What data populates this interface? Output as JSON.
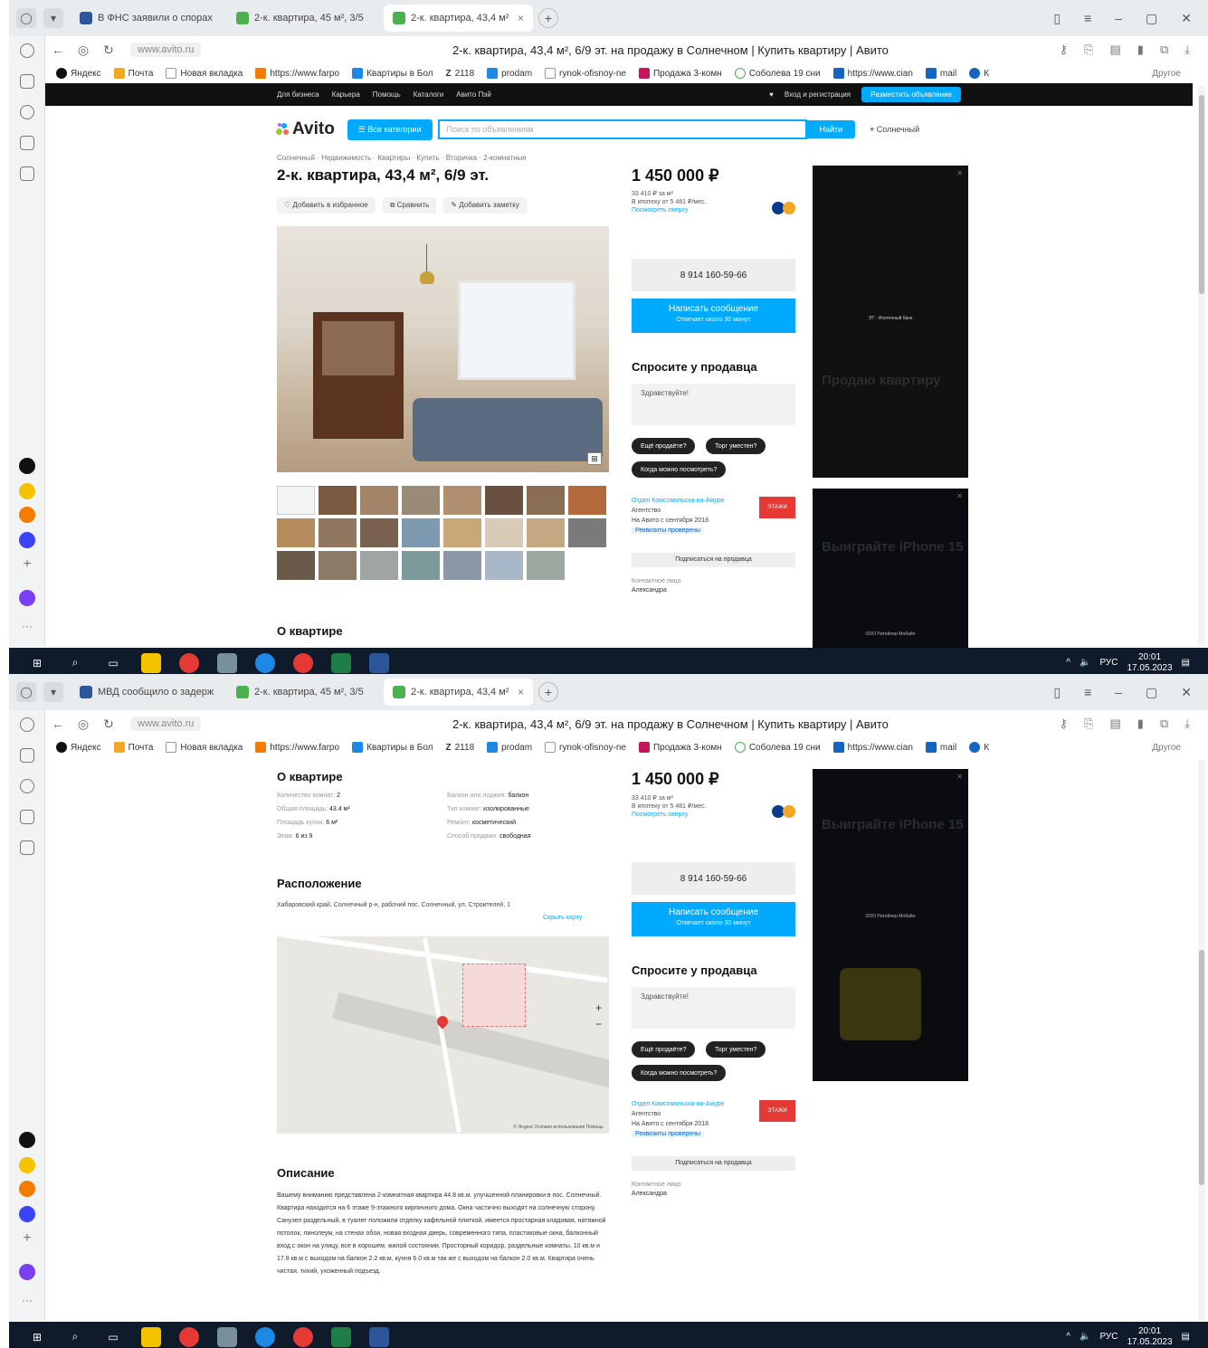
{
  "browser": {
    "tabs": [
      {
        "label": "В ФНС заявили о спорах",
        "color": "#2b579a"
      },
      {
        "label": "2-к. квартира, 45 м², 3/5",
        "color": "#4caf50"
      },
      {
        "label": "2-к. квартира, 43,4 м²",
        "color": "#4caf50"
      }
    ],
    "tabs_shot2": [
      {
        "label": "МВД сообщило о задерж",
        "color": "#2b579a"
      },
      {
        "label": "2-к. квартира, 45 м², 3/5",
        "color": "#4caf50"
      },
      {
        "label": "2-к. квартира, 43,4 м²",
        "color": "#4caf50"
      }
    ],
    "url": "www.avito.ru",
    "page_title": "2-к. квартира, 43,4 м², 6/9 эт. на продажу в Солнечном | Купить квартиру | Авито",
    "bookmarks": [
      {
        "label": "Яндекс",
        "color": "#111"
      },
      {
        "label": "Почта",
        "color": "#f5a623"
      },
      {
        "label": "Новая вкладка",
        "color": "#ccc"
      },
      {
        "label": "https://www.farpo",
        "color": "#f57c00"
      },
      {
        "label": "Квартиры в Бол",
        "color": "#1e88e5"
      },
      {
        "label": "2118",
        "color": "#333"
      },
      {
        "label": "prodam",
        "color": "#1e88e5"
      },
      {
        "label": "rynok-ofisnoy-ne",
        "color": "#ccc"
      },
      {
        "label": "Продажа 3-комн",
        "color": "#c2185b"
      },
      {
        "label": "Соболева 19 сни",
        "color": "#4caf50"
      },
      {
        "label": "https://www.cian",
        "color": "#1565c0"
      },
      {
        "label": "mail",
        "color": "#1565c0"
      },
      {
        "label": "К",
        "color": "#1565c0"
      }
    ],
    "bookmarks_more": "Другое",
    "clock_time": "20:01",
    "clock_date": "17.05.2023",
    "lang": "РУС"
  },
  "avito": {
    "top_links": [
      "Для бизнеса",
      "Карьера",
      "Помощь",
      "Каталоги",
      "Авито Пэй"
    ],
    "login": "Вход и регистрация",
    "post_ad": "Разместить объявление",
    "logo": "Avito",
    "categories_btn": "Все категории",
    "search_placeholder": "Поиск по объявлениям",
    "search_btn": "Найти",
    "location": "Солнечный",
    "breadcrumbs": "Солнечный · Недвижимость · Квартиры · Купить · Вторичка · 2-комнатные",
    "title": "2-к. квартира, 43,4 м², 6/9 эт.",
    "actions": [
      "Добавить в избранное",
      "Сравнить",
      "Добавить заметку"
    ],
    "price": "1 450 000 ₽",
    "price_per_m": "33 410 ₽ за м²",
    "mortgage": "В ипотеку от 5 481 ₽/мес.",
    "mortgage_link": "Посмотреть сверху",
    "phone": "8 914 160-59-66",
    "message_btn": "Написать сообщение",
    "message_sub": "Отвечает около 30 минут",
    "ask_heading": "Спросите у продавца",
    "ask_placeholder": "Здравствуйте!",
    "chips": [
      "Ещё продаёте?",
      "Торг уместен?",
      "Когда можно посмотреть?"
    ],
    "seller_name": "Отдел Комсомольска-на-Амуре",
    "seller_type": "Агентство",
    "seller_since": "На Авито с сентября 2018",
    "seller_badge": "Реквизиты проверены",
    "seller_logo": "ЭТАЖИ",
    "subscribe_btn": "Подписаться на продавца",
    "contact_label": "Контактное лицо",
    "contact_name": "Александра",
    "about_heading": "О квартире",
    "params": [
      {
        "k": "Количество комнат:",
        "v": "2"
      },
      {
        "k": "Балкон или лоджия:",
        "v": "балкон"
      },
      {
        "k": "Общая площадь:",
        "v": "43.4 м²"
      },
      {
        "k": "Тип комнат:",
        "v": "изолированные"
      },
      {
        "k": "Площадь кухни:",
        "v": "6 м²"
      },
      {
        "k": "Ремонт:",
        "v": "косметический"
      },
      {
        "k": "Этаж:",
        "v": "6 из 9"
      },
      {
        "k": "Способ продажи:",
        "v": "свободная"
      }
    ],
    "location_heading": "Расположение",
    "address": "Хабаровский край, Солнечный р-н, рабочий пос. Солнечный, ул. Строителей, 1",
    "map_link": "Скрыть карту",
    "map_copy": "© Яндекс Условия использования Помощь",
    "desc_heading": "Описание",
    "desc": "Вашему вниманию представлена 2-комнатная квартира 44.8 кв.м. улучшенной планировки в пос. Солнечный. Квартира находится на 6 этаже 9-этажного кирпичного дома. Окна частично выходят на солнечную сторону. Санузел раздельный, в туалет положили отделку кафельной плиткой, имеется простарная кладовая, натяжной потолок, линолеум, на стенах обои, новая входная дверь, современного типа, пластиковые окна, балконный вход с окон на улицу, все в хорошем, жилой состоянии. Просторный коридор, раздельные комнаты, 10 кв.м и 17.8 кв.м с выходом на балкон 2.2 кв.м, кухня 6.0 кв.м так же с выходом на балкон 2.0 кв.м. Квартира очень чистая, тихий, ухоженный подъезд.",
    "ad1_title": "Продаю квартиру",
    "ad1_caption": "ЭТ - Ипотечный банк",
    "ad2_title": "Выиграйте iPhone 15",
    "ad2_caption": "ООО Ритейлер Мобайл"
  }
}
